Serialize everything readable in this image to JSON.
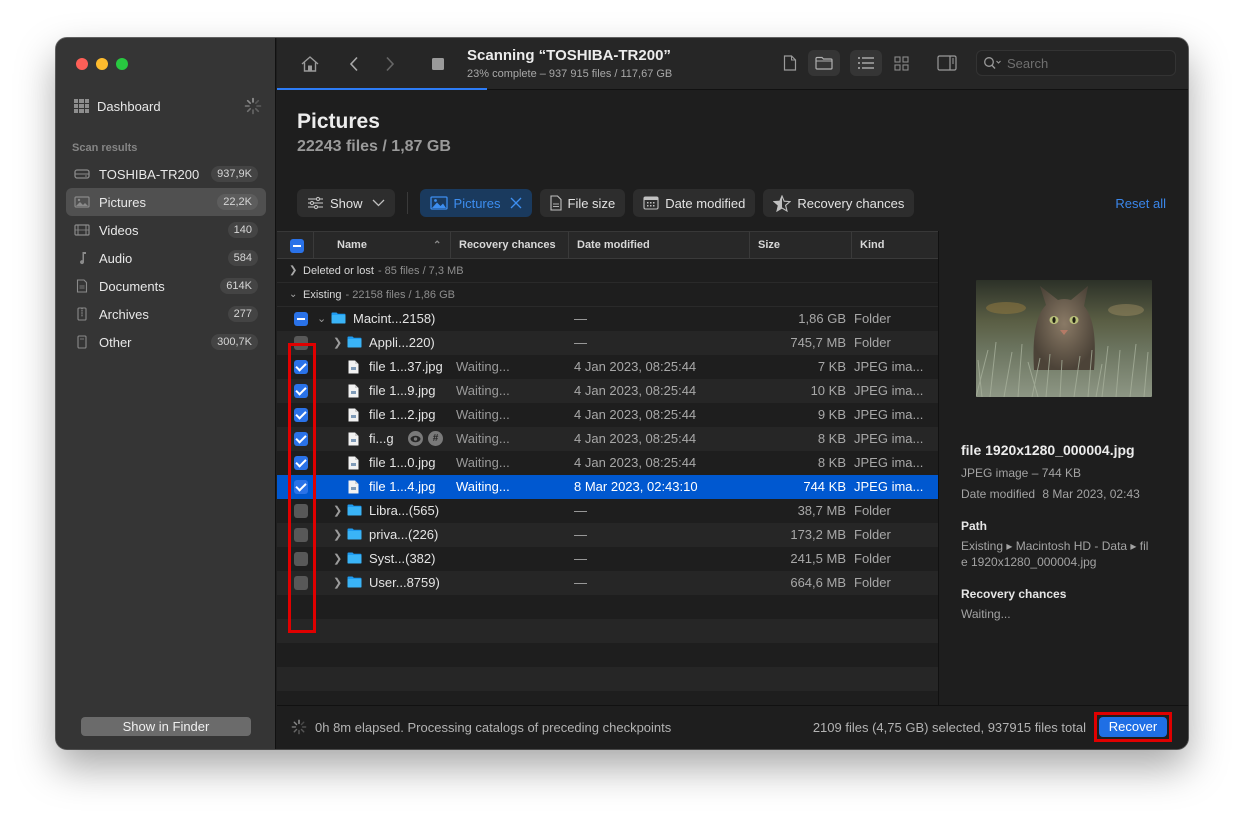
{
  "window": {
    "traffic_lights": [
      "close",
      "minimize",
      "zoom"
    ]
  },
  "sidebar": {
    "dashboard_label": "Dashboard",
    "section_title": "Scan results",
    "items": [
      {
        "label": "TOSHIBA-TR200",
        "count": "937,9K",
        "icon": "drive-icon",
        "active": false
      },
      {
        "label": "Pictures",
        "count": "22,2K",
        "icon": "picture-icon",
        "active": true
      },
      {
        "label": "Videos",
        "count": "140",
        "icon": "film-icon",
        "active": false
      },
      {
        "label": "Audio",
        "count": "584",
        "icon": "music-note-icon",
        "active": false
      },
      {
        "label": "Documents",
        "count": "614K",
        "icon": "document-icon",
        "active": false
      },
      {
        "label": "Archives",
        "count": "277",
        "icon": "archive-icon",
        "active": false
      },
      {
        "label": "Other",
        "count": "300,7K",
        "icon": "other-file-icon",
        "active": false
      }
    ],
    "show_in_finder_label": "Show in Finder"
  },
  "toolbar": {
    "title": "Scanning “TOSHIBA-TR200”",
    "subtitle": "23% complete – 937 915 files / 117,67 GB",
    "progress_percent": 23,
    "search_placeholder": "Search"
  },
  "content": {
    "heading": "Pictures",
    "subheading": "22243 files / 1,87 GB"
  },
  "filters": {
    "show_label": "Show",
    "chips": [
      {
        "label": "Pictures",
        "active": true,
        "icon": "image-icon"
      },
      {
        "label": "File size",
        "active": false,
        "icon": "file-icon"
      },
      {
        "label": "Date modified",
        "active": false,
        "icon": "calendar-icon"
      },
      {
        "label": "Recovery chances",
        "active": false,
        "icon": "star-icon"
      }
    ],
    "reset_label": "Reset all"
  },
  "table": {
    "columns": [
      "Name",
      "Recovery chances",
      "Date modified",
      "Size",
      "Kind"
    ],
    "groups": [
      {
        "name": "Deleted or lost",
        "meta": "- 85 files / 7,3 MB",
        "expanded": false
      },
      {
        "name": "Existing",
        "meta": "- 22158 files / 1,86 GB",
        "expanded": true
      }
    ],
    "rows": [
      {
        "name": "Macint...2158)",
        "type": "folder",
        "level": 0,
        "expanded": true,
        "check": "mixed",
        "recovery": "",
        "date": "—",
        "size": "1,86 GB",
        "kind": "Folder",
        "selected": false
      },
      {
        "name": "Appli...220)",
        "type": "folder",
        "level": 1,
        "expanded": false,
        "check": "none",
        "recovery": "",
        "date": "—",
        "size": "745,7 MB",
        "kind": "Folder",
        "selected": false
      },
      {
        "name": "file 1...37.jpg",
        "type": "file",
        "level": 1,
        "check": "checked",
        "recovery": "Waiting...",
        "date": "4 Jan 2023, 08:25:44",
        "size": "7 KB",
        "kind": "JPEG ima...",
        "selected": false
      },
      {
        "name": "file 1...9.jpg",
        "type": "file",
        "level": 1,
        "check": "checked",
        "recovery": "Waiting...",
        "date": "4 Jan 2023, 08:25:44",
        "size": "10 KB",
        "kind": "JPEG ima...",
        "selected": false
      },
      {
        "name": "file 1...2.jpg",
        "type": "file",
        "level": 1,
        "check": "checked",
        "recovery": "Waiting...",
        "date": "4 Jan 2023, 08:25:44",
        "size": "9 KB",
        "kind": "JPEG ima...",
        "selected": false
      },
      {
        "name": "fi...g",
        "type": "file",
        "level": 1,
        "check": "checked",
        "recovery": "Waiting...",
        "date": "4 Jan 2023, 08:25:44",
        "size": "8 KB",
        "kind": "JPEG ima...",
        "selected": false,
        "badges": [
          "eye-icon",
          "hash-icon"
        ]
      },
      {
        "name": "file 1...0.jpg",
        "type": "file",
        "level": 1,
        "check": "checked",
        "recovery": "Waiting...",
        "date": "4 Jan 2023, 08:25:44",
        "size": "8 KB",
        "kind": "JPEG ima...",
        "selected": false
      },
      {
        "name": "file 1...4.jpg",
        "type": "file",
        "level": 1,
        "check": "checked",
        "recovery": "Waiting...",
        "date": "8 Mar 2023, 02:43:10",
        "size": "744 KB",
        "kind": "JPEG ima...",
        "selected": true
      },
      {
        "name": "Libra...(565)",
        "type": "folder",
        "level": 1,
        "expanded": false,
        "check": "none",
        "recovery": "",
        "date": "—",
        "size": "38,7 MB",
        "kind": "Folder",
        "selected": false
      },
      {
        "name": "priva...(226)",
        "type": "folder",
        "level": 1,
        "expanded": false,
        "check": "none",
        "recovery": "",
        "date": "—",
        "size": "173,2 MB",
        "kind": "Folder",
        "selected": false
      },
      {
        "name": "Syst...(382)",
        "type": "folder",
        "level": 1,
        "expanded": false,
        "check": "none",
        "recovery": "",
        "date": "—",
        "size": "241,5 MB",
        "kind": "Folder",
        "selected": false
      },
      {
        "name": "User...8759)",
        "type": "folder",
        "level": 1,
        "expanded": false,
        "check": "none",
        "recovery": "",
        "date": "—",
        "size": "664,6 MB",
        "kind": "Folder",
        "selected": false
      }
    ]
  },
  "preview": {
    "file_name": "file 1920x1280_000004.jpg",
    "type_size": "JPEG image – 744 KB",
    "date_label": "Date modified",
    "date_value": "8 Mar 2023, 02:43",
    "path_heading": "Path",
    "path_line1": "Existing ▸ Macintosh HD - Data ▸ fil",
    "path_line2": "e 1920x1280_000004.jpg",
    "recovery_heading": "Recovery chances",
    "recovery_value": "Waiting..."
  },
  "statusbar": {
    "elapsed_text": "0h 8m elapsed. Processing catalogs of preceding checkpoints",
    "selection_text": "2109 files (4,75 GB) selected, 937915 files total",
    "recover_label": "Recover"
  },
  "colors": {
    "accent": "#2a72e8",
    "selection": "#0058d0",
    "highlight_box": "#e00000"
  }
}
